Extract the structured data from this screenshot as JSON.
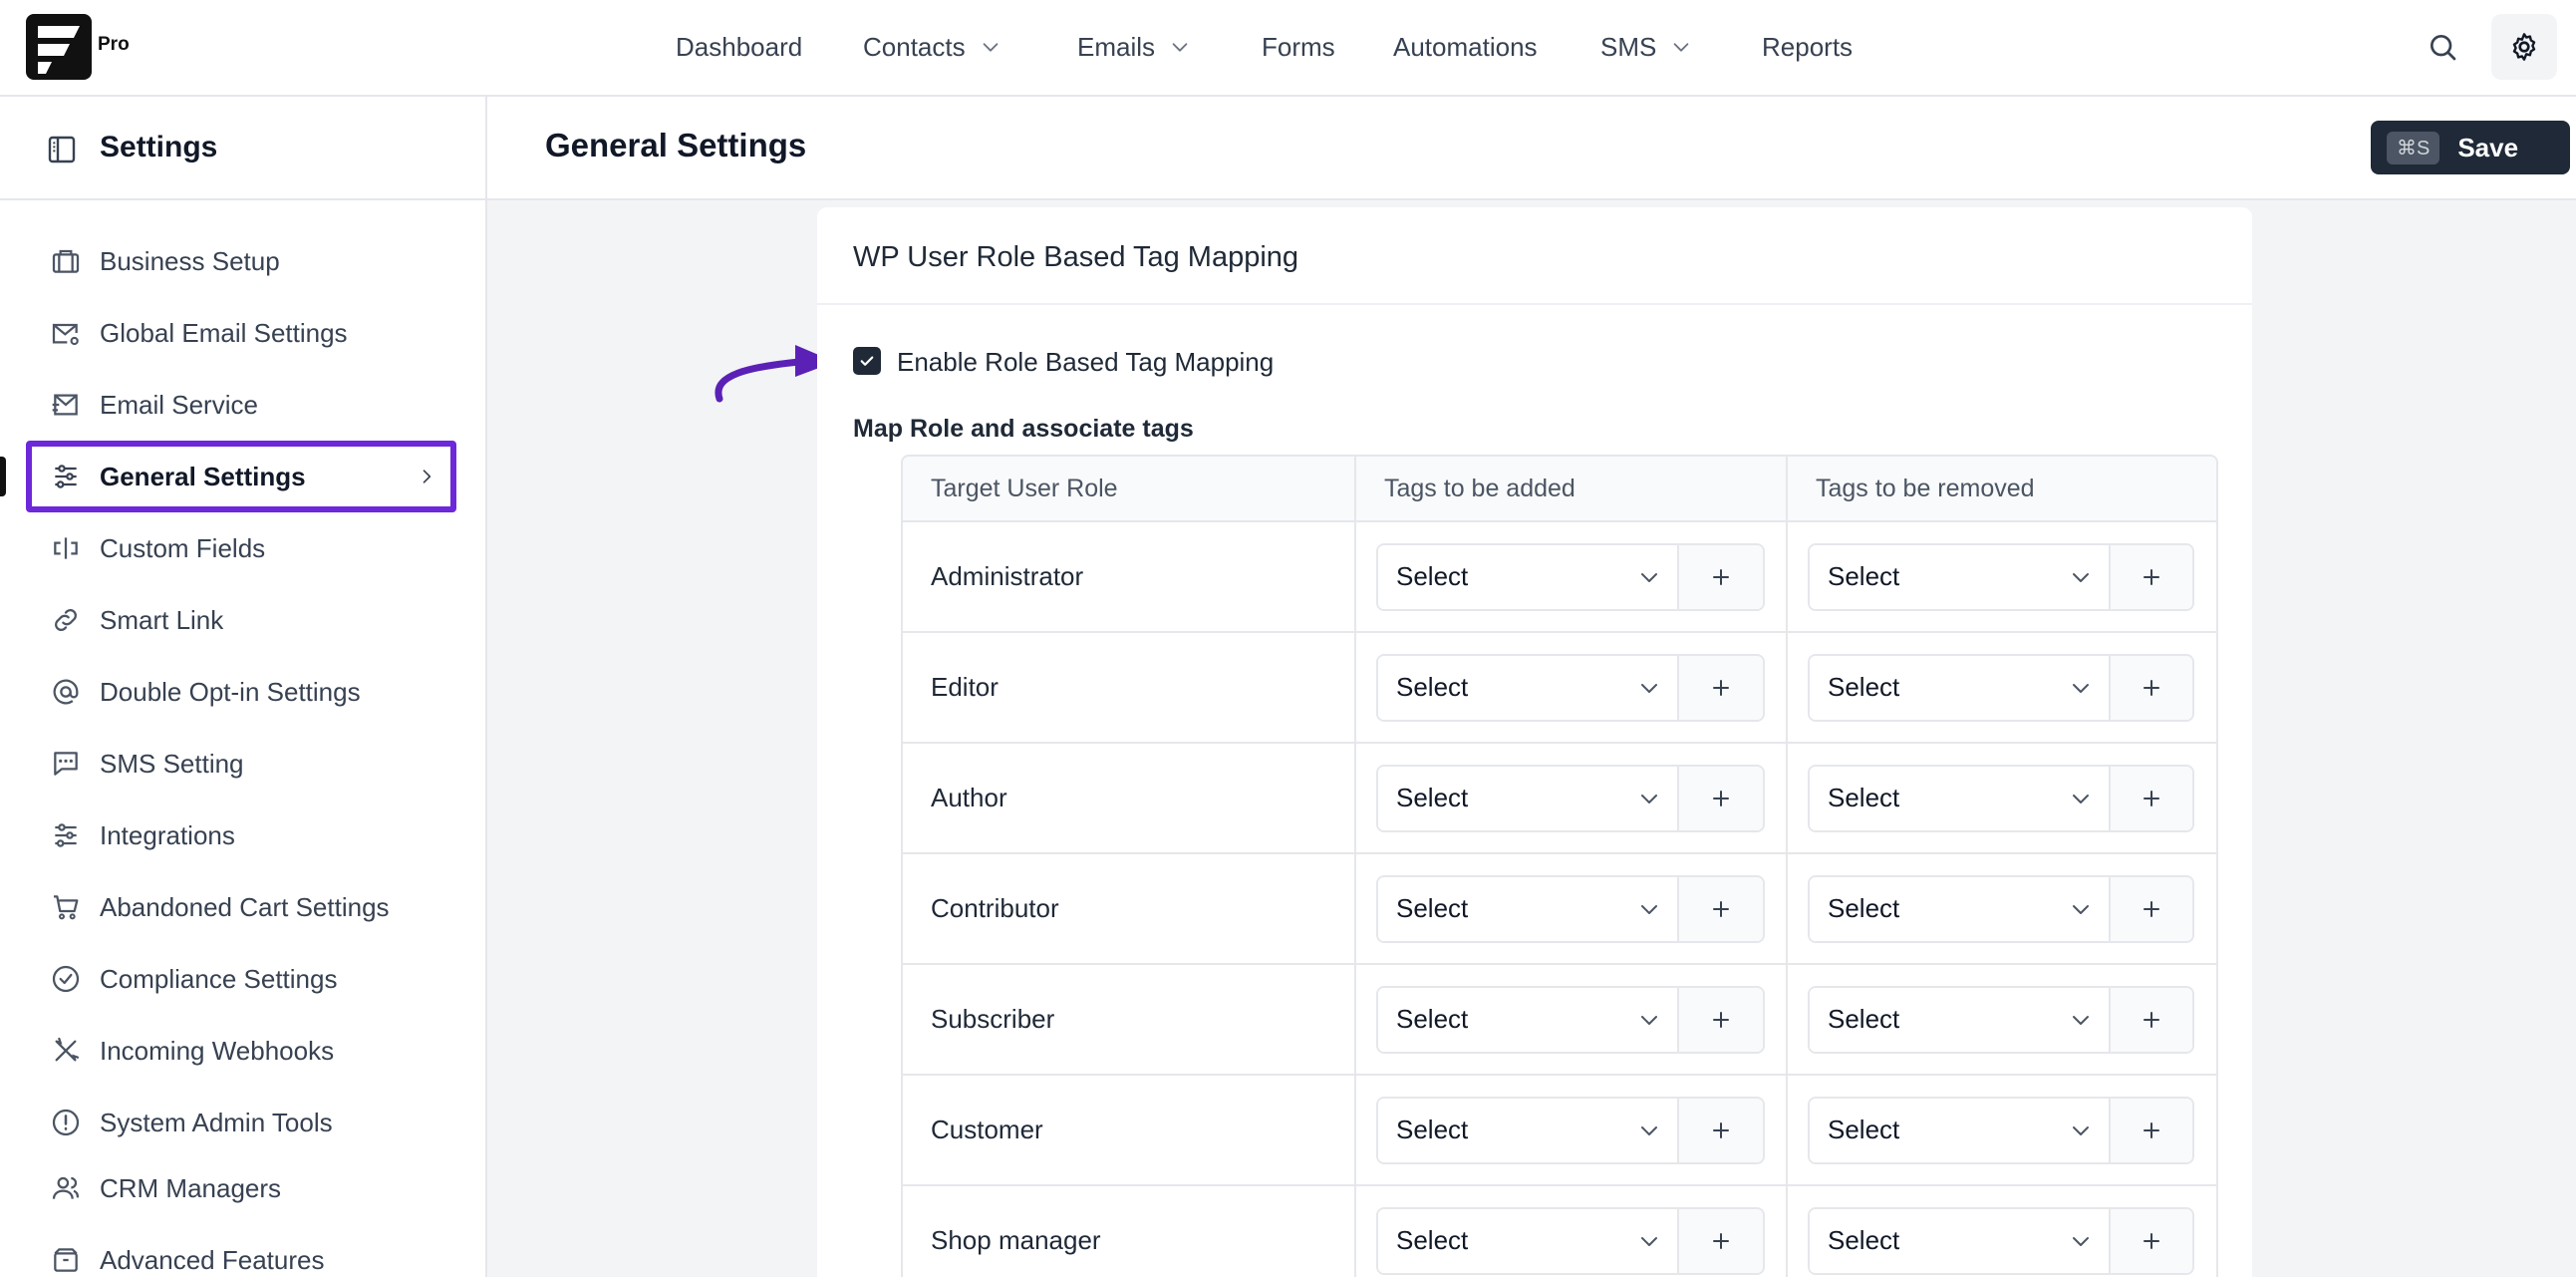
{
  "brand": {
    "badge": "Pro"
  },
  "topnav": {
    "items": [
      {
        "label": "Dashboard",
        "dropdown": false
      },
      {
        "label": "Contacts",
        "dropdown": true
      },
      {
        "label": "Emails",
        "dropdown": true
      },
      {
        "label": "Forms",
        "dropdown": false
      },
      {
        "label": "Automations",
        "dropdown": false
      },
      {
        "label": "SMS",
        "dropdown": true
      },
      {
        "label": "Reports",
        "dropdown": false
      }
    ]
  },
  "sidebar": {
    "title": "Settings",
    "items": [
      {
        "label": "Business Setup",
        "icon": "briefcase-icon"
      },
      {
        "label": "Global Email Settings",
        "icon": "mail-gear-icon"
      },
      {
        "label": "Email Service",
        "icon": "mail-send-icon"
      },
      {
        "label": "General Settings",
        "icon": "sliders-icon",
        "active": true
      },
      {
        "label": "Custom Fields",
        "icon": "custom-fields-icon"
      },
      {
        "label": "Smart Link",
        "icon": "link-icon"
      },
      {
        "label": "Double Opt-in Settings",
        "icon": "at-icon"
      },
      {
        "label": "SMS Setting",
        "icon": "message-icon"
      },
      {
        "label": "Integrations",
        "icon": "sliders-icon"
      },
      {
        "label": "Abandoned Cart Settings",
        "icon": "cart-icon"
      },
      {
        "label": "Compliance Settings",
        "icon": "check-circle-icon"
      },
      {
        "label": "Incoming Webhooks",
        "icon": "tools-icon"
      },
      {
        "label": "System Admin Tools",
        "icon": "alert-circle-icon"
      },
      {
        "label": "CRM Managers",
        "icon": "users-icon"
      },
      {
        "label": "Advanced Features",
        "icon": "package-icon"
      }
    ]
  },
  "header": {
    "title": "General Settings",
    "save_shortcut": "⌘S",
    "save_label": "Save"
  },
  "card": {
    "title": "WP User Role Based Tag Mapping",
    "enable_label": "Enable Role Based Tag Mapping",
    "enable_checked": true,
    "map_label": "Map Role and associate tags",
    "columns": [
      "Target User Role",
      "Tags to be added",
      "Tags to be removed"
    ],
    "select_placeholder": "Select",
    "rows": [
      {
        "role": "Administrator",
        "add": "Select",
        "remove": "Select"
      },
      {
        "role": "Editor",
        "add": "Select",
        "remove": "Select"
      },
      {
        "role": "Author",
        "add": "Select",
        "remove": "Select"
      },
      {
        "role": "Contributor",
        "add": "Select",
        "remove": "Select"
      },
      {
        "role": "Subscriber",
        "add": "Select",
        "remove": "Select"
      },
      {
        "role": "Customer",
        "add": "Select",
        "remove": "Select"
      },
      {
        "role": "Shop manager",
        "add": "Select",
        "remove": "Select"
      }
    ]
  },
  "colors": {
    "accent_highlight": "#6d28d9",
    "save_button": "#1f2937",
    "page_bg": "#f3f4f6"
  }
}
